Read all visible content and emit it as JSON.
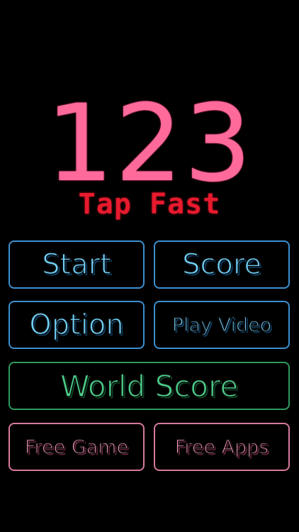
{
  "logo": {
    "number": "123",
    "subtitle": "Tap Fast"
  },
  "menu": {
    "start": "Start",
    "score": "Score",
    "option": "Option",
    "play_video": "Play Video",
    "world_score": "World Score",
    "free_game": "Free Game",
    "free_apps": "Free Apps"
  },
  "colors": {
    "background": "#000000",
    "logo_pink": "#ff6a9a",
    "subtitle_red": "#e81a2e",
    "blue_border": "#3c8fcf",
    "blue_text": "#6fd0f8",
    "green_border": "#2f9a5d",
    "green_text": "#4cd08b",
    "pink_border": "#d77a9f",
    "pink_text": "#ff9ec1"
  }
}
